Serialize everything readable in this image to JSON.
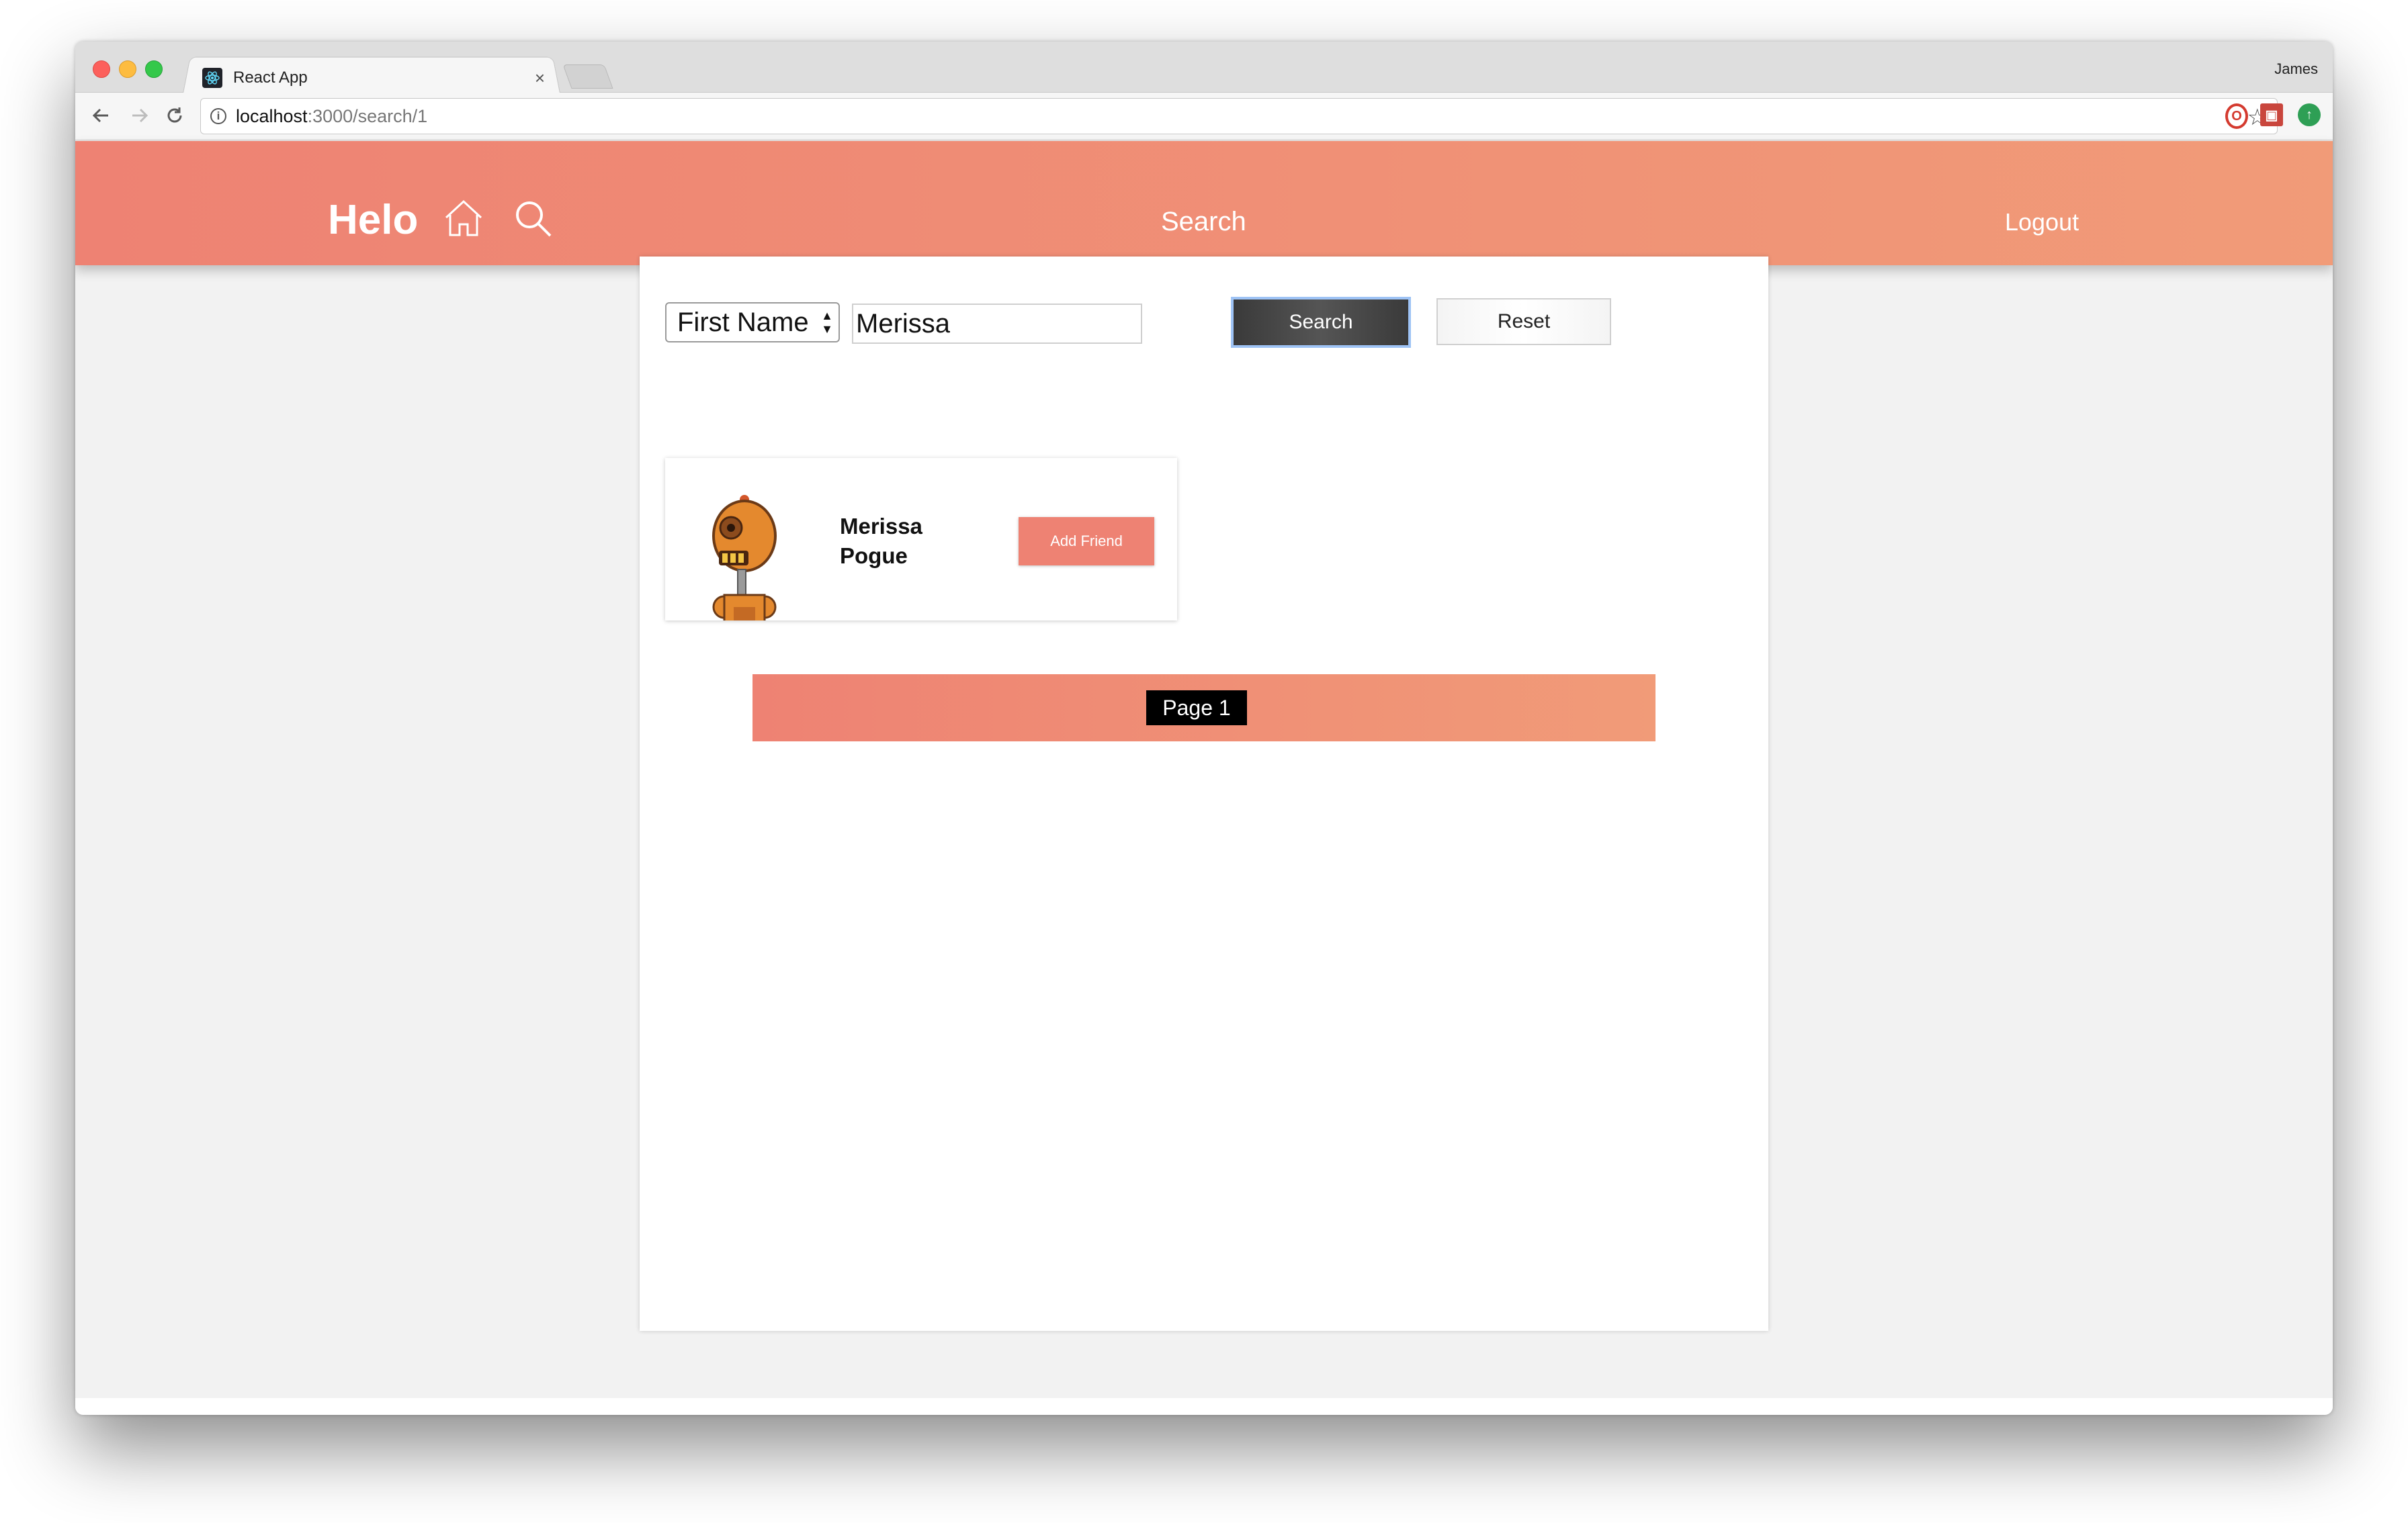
{
  "browser": {
    "tab_title": "React App",
    "tab_close": "×",
    "profile_name": "James",
    "url_host": "localhost",
    "url_path": ":3000/search/1"
  },
  "header": {
    "brand": "Helo",
    "title": "Search",
    "logout": "Logout"
  },
  "search": {
    "field_select_value": "First Name",
    "query_value": "Merissa",
    "search_button": "Search",
    "reset_button": "Reset"
  },
  "results": [
    {
      "first_name": "Merissa",
      "last_name": "Pogue",
      "action": "Add Friend"
    }
  ],
  "pagination": {
    "label": "Page 1"
  },
  "colors": {
    "header_gradient_start": "#ee8273",
    "header_gradient_end": "#f19b78",
    "accent": "#ee8273"
  }
}
